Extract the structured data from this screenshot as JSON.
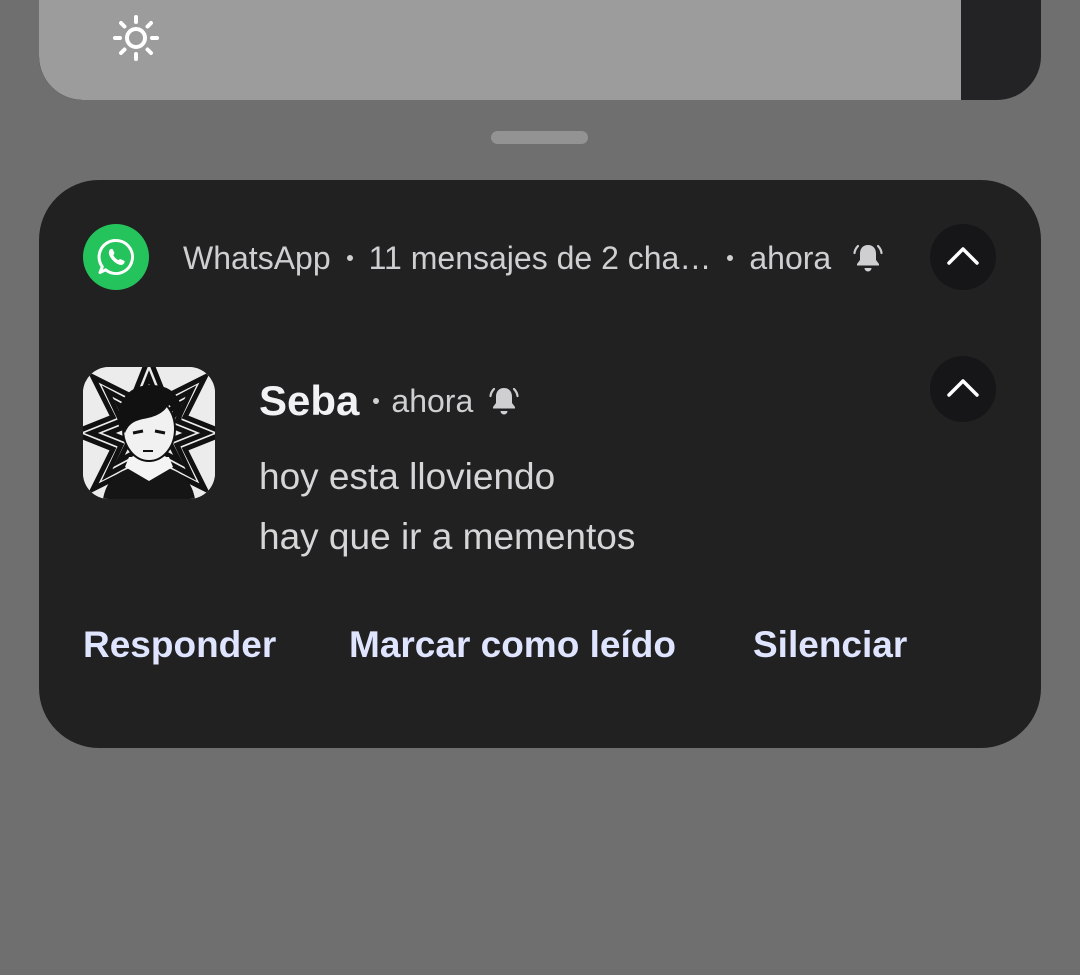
{
  "brightness": {
    "icon": "sun-icon",
    "level_percent": 92
  },
  "notification": {
    "app_icon": "whatsapp-icon",
    "app_name": "WhatsApp",
    "summary": "11 mensajes de 2 cha…",
    "time": "ahora",
    "bell_icon": "bell-icon",
    "accent_color": "#25c35b",
    "message": {
      "sender": "Seba",
      "time": "ahora",
      "lines": [
        "hoy esta lloviendo",
        "hay que ir a mementos"
      ]
    },
    "actions": {
      "reply": "Responder",
      "mark_read": "Marcar como leído",
      "mute": "Silenciar"
    }
  }
}
